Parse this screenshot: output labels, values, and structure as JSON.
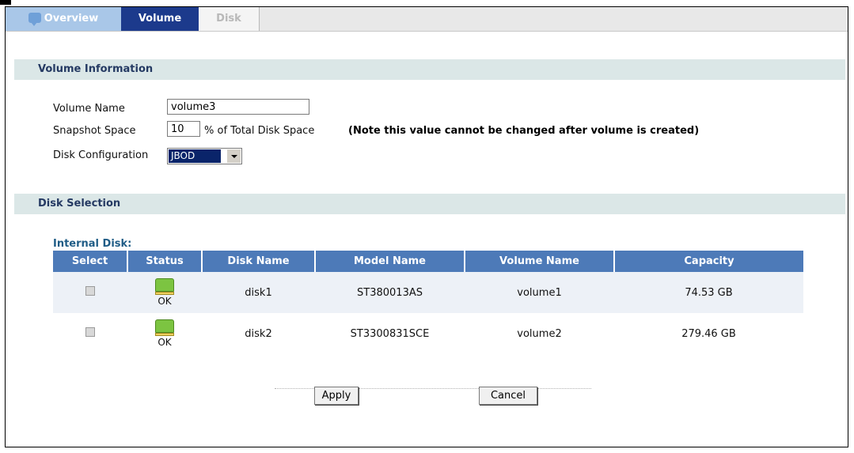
{
  "tabs": {
    "overview": "Overview",
    "volume": "Volume",
    "disk": "Disk"
  },
  "volume_info": {
    "header": "Volume Information",
    "volume_name_label": "Volume Name",
    "volume_name_value": "volume3",
    "snapshot_label": "Snapshot Space",
    "snapshot_value": "10",
    "snapshot_suffix": "% of Total Disk Space",
    "snapshot_note": "(Note this value cannot be changed after volume is created)",
    "disk_config_label": "Disk Configuration",
    "disk_config_value": "JBOD"
  },
  "disk_selection": {
    "header": "Disk Selection",
    "subheader": "Internal Disk:",
    "columns": [
      "Select",
      "Status",
      "Disk Name",
      "Model Name",
      "Volume Name",
      "Capacity"
    ],
    "rows": [
      {
        "status": "OK",
        "disk_name": "disk1",
        "model_name": "ST380013AS",
        "volume_name": "volume1",
        "capacity": "74.53 GB"
      },
      {
        "status": "OK",
        "disk_name": "disk2",
        "model_name": "ST3300831SCE",
        "volume_name": "volume2",
        "capacity": "279.46 GB"
      }
    ]
  },
  "buttons": {
    "apply": "Apply",
    "cancel": "Cancel"
  },
  "colors": {
    "tab_active": "#1c3a8c",
    "tab_overview": "#a9c7e8",
    "section_header_bg": "#dbe7e7",
    "table_header_bg": "#4d7ab8",
    "subheader_text": "#1f5c86"
  }
}
